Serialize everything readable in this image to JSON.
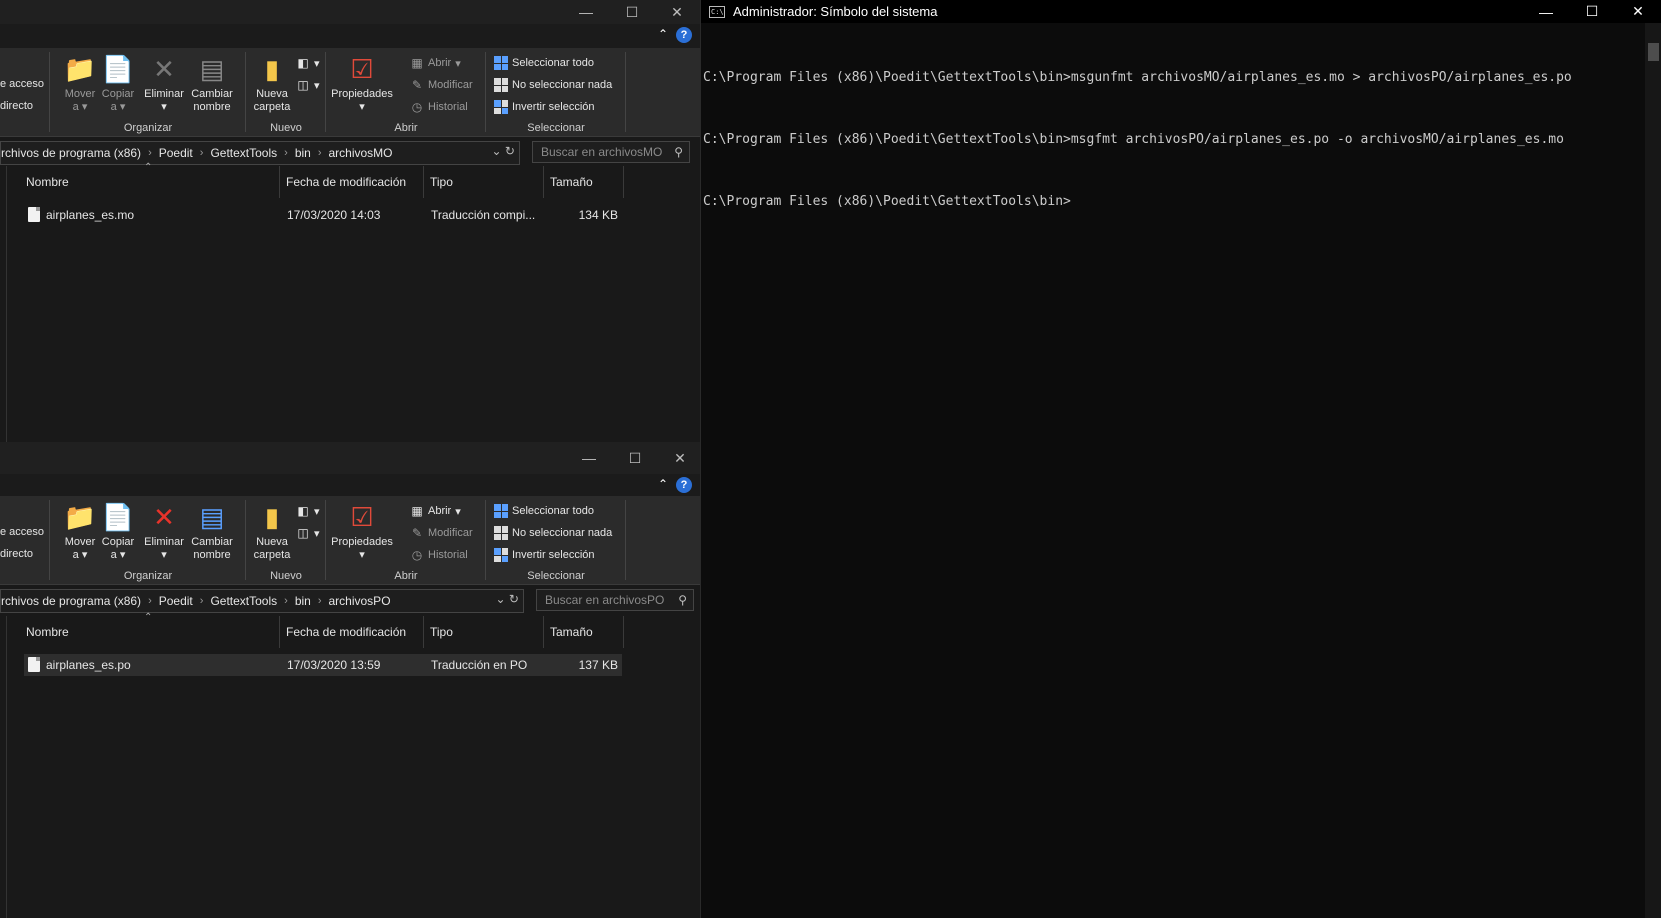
{
  "ribbon": {
    "acceso_line1": "e acceso",
    "acceso_line2": "directo",
    "mover_1": "Mover",
    "mover_2": "a",
    "copiar_1": "Copiar",
    "copiar_2": "a",
    "eliminar": "Eliminar",
    "cambiar_1": "Cambiar",
    "cambiar_2": "nombre",
    "nueva_1": "Nueva",
    "nueva_2": "carpeta",
    "propiedades": "Propiedades",
    "abrir": "Abrir",
    "modificar": "Modificar",
    "historial": "Historial",
    "seleccionar_todo": "Seleccionar todo",
    "no_seleccionar": "No seleccionar nada",
    "invertir": "Invertir selección",
    "g_organizar": "Organizar",
    "g_nuevo": "Nuevo",
    "g_abrir": "Abrir",
    "g_seleccionar": "Seleccionar"
  },
  "columns": {
    "nombre": "Nombre",
    "fecha": "Fecha de modificación",
    "tipo": "Tipo",
    "tamano": "Tamaño"
  },
  "explorer1": {
    "crumbs": [
      "rchivos de programa (x86)",
      "Poedit",
      "GettextTools",
      "bin",
      "archivosMO"
    ],
    "search_placeholder": "Buscar en archivosMO",
    "file": {
      "name": "airplanes_es.mo",
      "date": "17/03/2020 14:03",
      "type": "Traducción compi...",
      "size": "134 KB"
    }
  },
  "explorer2": {
    "crumbs": [
      "rchivos de programa (x86)",
      "Poedit",
      "GettextTools",
      "bin",
      "archivosPO"
    ],
    "search_placeholder": "Buscar en archivosPO",
    "file": {
      "name": "airplanes_es.po",
      "date": "17/03/2020 13:59",
      "type": "Traducción en PO",
      "size": "137 KB"
    }
  },
  "cmd": {
    "title": "Administrador: Símbolo del sistema",
    "lines": [
      "C:\\Program Files (x86)\\Poedit\\GettextTools\\bin>msgunfmt archivosMO/airplanes_es.mo > archivosPO/airplanes_es.po",
      "C:\\Program Files (x86)\\Poedit\\GettextTools\\bin>msgfmt archivosPO/airplanes_es.po -o archivosMO/airplanes_es.mo",
      "C:\\Program Files (x86)\\Poedit\\GettextTools\\bin>"
    ]
  },
  "icons": {
    "minimize": "minimize-icon",
    "maximize": "maximize-icon",
    "close": "close-icon",
    "help": "?"
  }
}
